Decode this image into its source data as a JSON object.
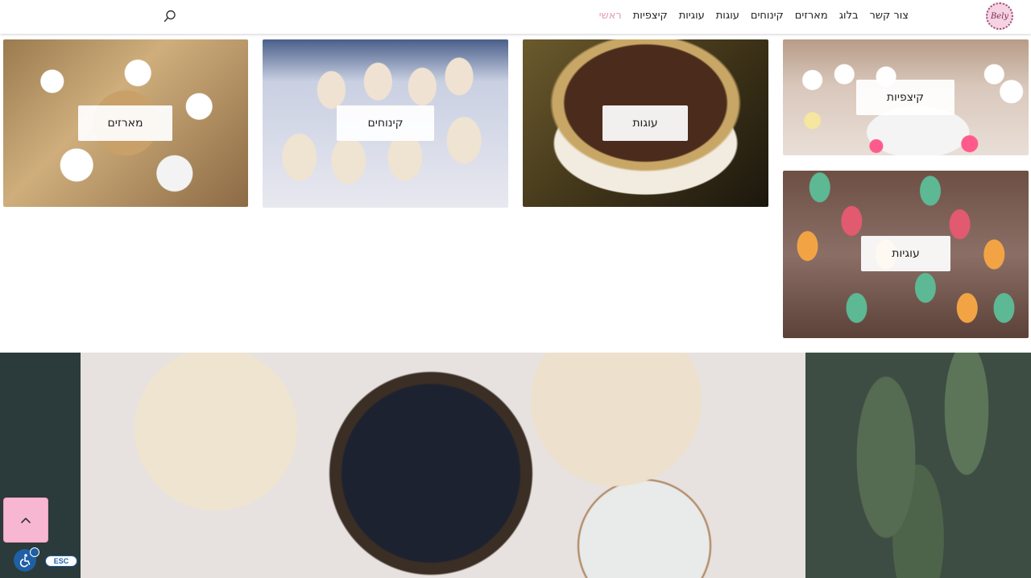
{
  "header": {
    "logo_text": "Bely",
    "nav": [
      {
        "label": "ראשי",
        "active": true
      },
      {
        "label": "קיצפיות"
      },
      {
        "label": "עוגיות"
      },
      {
        "label": "עוגות"
      },
      {
        "label": "קינוחים"
      },
      {
        "label": "מארזים"
      },
      {
        "label": "בלוג"
      },
      {
        "label": "צור קשר"
      }
    ],
    "search_icon": "search-icon"
  },
  "gallery": {
    "meringue_boxes": "מארזים",
    "desserts": "קינוחים",
    "cakes": "עוגות",
    "meringues": "קיצפיות",
    "cookies": "עוגיות"
  },
  "floating": {
    "scroll_top_icon": "chevron-up-icon",
    "accessibility_icon": "accessibility-icon",
    "esc_label": "ESC"
  },
  "colors": {
    "accent_pink": "#f7b7d2",
    "nav_active": "#e39bb7",
    "a11y_blue": "#1f5fa5"
  }
}
